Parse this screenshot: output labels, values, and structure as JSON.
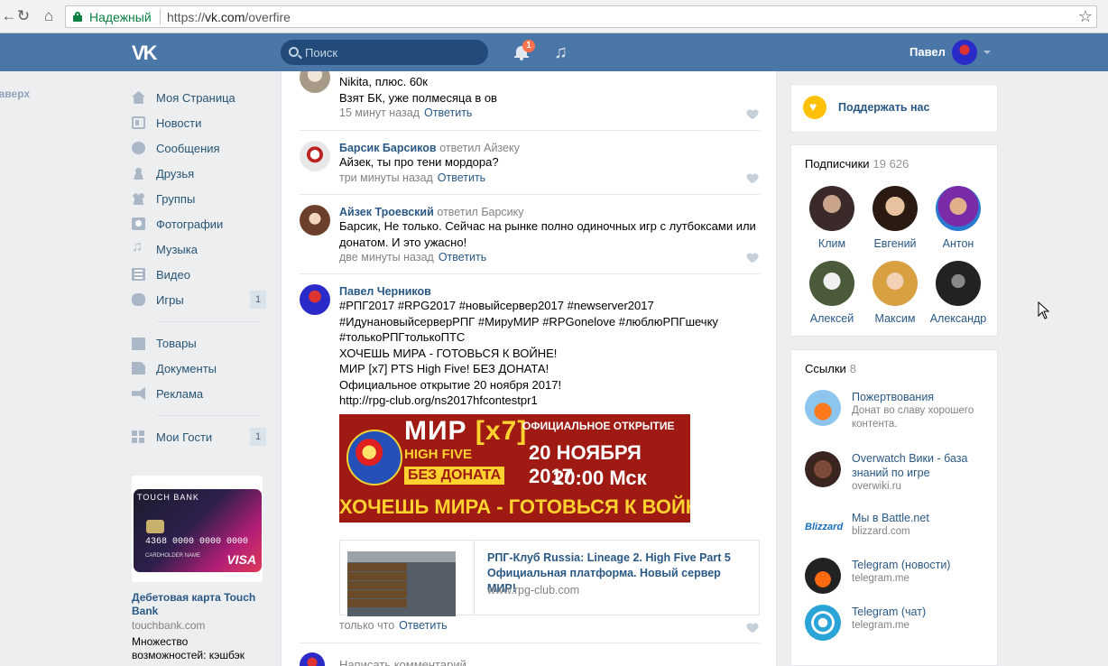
{
  "browser": {
    "secure_label": "Надежный",
    "url_scheme": "https://",
    "url_host": "vk.com",
    "url_path": "/overfire"
  },
  "header": {
    "search_placeholder": "Поиск",
    "notifications_count": "1",
    "user_name": "Павел"
  },
  "to_top": "Наверх",
  "menu": {
    "items": [
      {
        "label": "Моя Страница",
        "icon": "home-icon"
      },
      {
        "label": "Новости",
        "icon": "news-icon"
      },
      {
        "label": "Сообщения",
        "icon": "messages-icon"
      },
      {
        "label": "Друзья",
        "icon": "friends-icon"
      },
      {
        "label": "Группы",
        "icon": "groups-icon"
      },
      {
        "label": "Фотографии",
        "icon": "photos-icon"
      },
      {
        "label": "Музыка",
        "icon": "music-icon"
      },
      {
        "label": "Видео",
        "icon": "video-icon"
      },
      {
        "label": "Игры",
        "icon": "games-icon",
        "count": "1"
      }
    ],
    "items2": [
      {
        "label": "Товары",
        "icon": "goods-icon"
      },
      {
        "label": "Документы",
        "icon": "documents-icon"
      },
      {
        "label": "Реклама",
        "icon": "ads-icon"
      }
    ],
    "items3": [
      {
        "label": "Мои Гости",
        "icon": "guests-icon",
        "count": "1"
      }
    ]
  },
  "ad": {
    "card_brand": "TOUCH BANK",
    "card_number": "4368 0000 0000 0000",
    "card_holder": "CARDHOLDER NAME",
    "card_network": "VISA",
    "title": "Дебетовая карта Touch Bank",
    "domain": "touchbank.com",
    "text": "Множество возможностей: кэшбэк"
  },
  "feed": {
    "comments": [
      {
        "author": "",
        "text": "Nikita, плюс. 60к",
        "text2": "Взят БК, уже полмесяца в ов",
        "time": "15 минут назад",
        "reply": "Ответить"
      },
      {
        "author": "Барсик Барсиков",
        "reply_to": "ответил Айзеку",
        "text": "Айзек, ты про тени мордора?",
        "time": "три минуты назад",
        "reply": "Ответить"
      },
      {
        "author": "Айзек Троевский",
        "reply_to": "ответил Барсику",
        "text": "Барсик, Не только. Сейчас на рынке полно одиночных игр с лутбоксами или донатом. И это ужасно!",
        "time": "две минуты назад",
        "reply": "Ответить"
      },
      {
        "author": "Павел Черников",
        "hashtags": "#РПГ2017 #RPG2017 #новыйсервер2017 #newserver2017 #ИдунановыйсерверРПГ #МируМИР #RPGonelove #люблюРПГшечку #толькоРПГтолькоПТС",
        "line1": "ХОЧЕШЬ МИРА - ГОТОВЬСЯ К ВОЙНЕ!",
        "line2": "МИР [x7] PTS High Five! БЕЗ ДОНАТА!",
        "line3": "Официальное открытие 20 ноября 2017!",
        "link": "http://rpg-club.org/ns2017hfcontestpr1",
        "time": "только что",
        "reply": "Ответить"
      }
    ],
    "banner": {
      "mir": "МИР",
      "x7": "[x7]",
      "high_five": "HIGH FIVE",
      "no_donate": "БЕЗ ДОНАТА",
      "official_opening": "ОФИЦИАЛЬНОЕ ОТКРЫТИЕ",
      "date": "20 НОЯБРЯ 2017",
      "time": "20:00 Мск",
      "slogan": "ХОЧЕШЬ МИРА - ГОТОВЬСЯ К ВОЙНЕ"
    },
    "snippet": {
      "title": "РПГ-Клуб Russia: Lineage 2. High Five Part 5 Официальная платформа. Новый сервер МИР!",
      "domain": "www.rpg-club.com"
    },
    "write_placeholder": "Написать комментарий..."
  },
  "right": {
    "donate_label": "Поддержать нас",
    "subscribers_title": "Подписчики",
    "subscribers_count": "19 626",
    "subscribers": [
      {
        "name": "Клим"
      },
      {
        "name": "Евгений"
      },
      {
        "name": "Антон"
      },
      {
        "name": "Алексей"
      },
      {
        "name": "Максим"
      },
      {
        "name": "Александр"
      }
    ],
    "links_title": "Ссылки",
    "links_count": "8",
    "links": [
      {
        "title": "Пожертвования",
        "desc": "Донат во славу хорошего контента."
      },
      {
        "title": "Overwatch Вики - база знаний по игре",
        "desc": "overwiki.ru"
      },
      {
        "title": "Мы в Battle.net",
        "desc": "blizzard.com"
      },
      {
        "title": "Telegram (новости)",
        "desc": "telegram.me"
      },
      {
        "title": "Telegram (чат)",
        "desc": "telegram.me"
      }
    ]
  },
  "colors": {
    "vk_blue": "#4a76a8",
    "link": "#2a5885",
    "muted": "#828282",
    "background": "#edeef0"
  }
}
